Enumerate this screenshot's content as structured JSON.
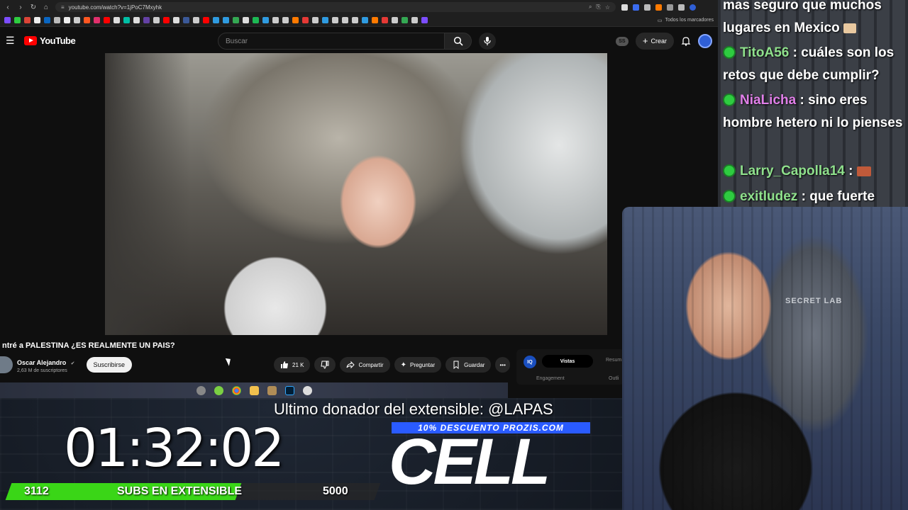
{
  "browser": {
    "url": "youtube.com/watch?v=1jPoC7Mxyhk",
    "bookmarks_folder": "Todos los marcadores"
  },
  "youtube": {
    "logo_text": "YouTube",
    "search_placeholder": "Buscar",
    "ss_badge": "SS",
    "create_label": "Crear",
    "video_title": "ntré a PALESTINA ¿ES REALMENTE UN PAIS?",
    "channel_name": "Oscar Alejandro",
    "channel_subs": "2,63 M de suscriptores",
    "subscribe_label": "Suscribirse",
    "like_count": "21 K",
    "share_label": "Compartir",
    "ask_label": "Preguntar",
    "save_label": "Guardar",
    "more_label": "•••",
    "panel": {
      "badge": "IQ",
      "tab_active": "Vistas",
      "tab_other": "Resum",
      "engagement": "Engagement",
      "outline": "Outli"
    }
  },
  "chat": {
    "messages": [
      {
        "user": "",
        "text": "mas seguro que muchos lugares en Mexico",
        "user_color": "#ffffff"
      },
      {
        "user": "TitoA56",
        "text": ": cuáles son los retos que debe cumplir?",
        "user_color": "#8fe08c"
      },
      {
        "user": "NiaLicha",
        "text": ": sino eres hombre hetero ni lo pienses",
        "user_color": "#e07fe8"
      },
      {
        "user": "Larry_Capolla14",
        "text": ":",
        "user_color": "#8fe08c"
      },
      {
        "user": "exitludez",
        "text": ": que fuerte",
        "user_color": "#8fe08c"
      }
    ]
  },
  "webcam": {
    "chair_brand": "SECRET LAB"
  },
  "overlay": {
    "donor_text": "Ultimo donador del extensible: @LAPAS",
    "promo": "10% DESCUENTO PROZIS.COM",
    "sponsor_logo": "CELL",
    "timer": "01:32:02",
    "subgoal": {
      "current": "3112",
      "label": "SUBS EN EXTENSIBLE",
      "target": "5000",
      "progress": 0.6224,
      "fill_color": "#3ad617"
    }
  },
  "colors": {
    "youtube_red": "#ff0000",
    "chat_user_green": "#8fe08c",
    "chat_user_pink": "#e07fe8",
    "promo_blue": "#2a5bff"
  }
}
